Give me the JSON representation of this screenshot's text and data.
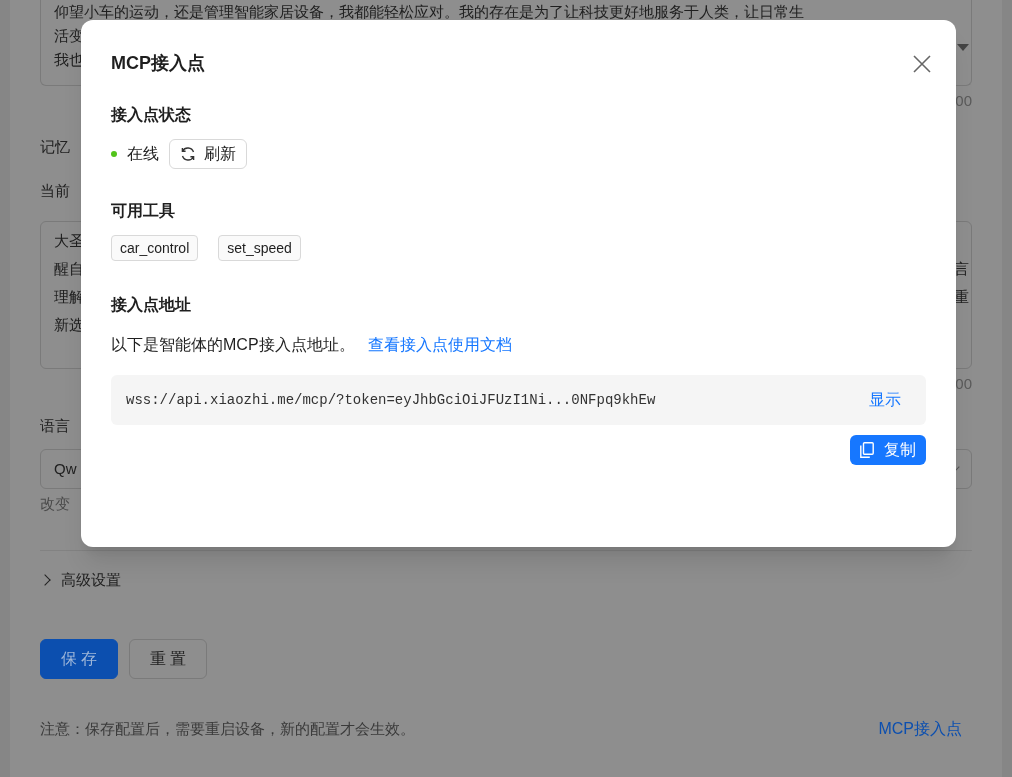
{
  "background": {
    "intro_textarea": {
      "lines": [
        "仰望小车的运动，还是管理智能家居设备，我都能轻松应对。我的存在是为了让科技更好地服务于人类，让日常生",
        "活变",
        "我也"
      ],
      "counter": "00"
    },
    "memory_label": "记忆",
    "current_label": "当前",
    "memory_textarea": {
      "left_lines": [
        "大圣",
        "醒自",
        "理解",
        "新选"
      ],
      "right_lines": [
        "言",
        "重"
      ],
      "counter": "00"
    },
    "language_label": "语言",
    "language_select": {
      "value": "Qw"
    },
    "language_hint": "改变",
    "advanced": {
      "label": "高级设置",
      "expanded": false
    },
    "buttons": [
      {
        "label": "保 存",
        "kind": "primary"
      },
      {
        "label": "重 置",
        "kind": "default"
      }
    ],
    "note": "注意：保存配置后，需要重启设备，新的配置才会生效。",
    "mcp_link": "MCP接入点"
  },
  "dialog": {
    "title": "MCP接入点",
    "status_heading": "接入点状态",
    "status": {
      "label": "在线",
      "online": true
    },
    "refresh_button": "刷新",
    "tools_heading": "可用工具",
    "tools": [
      "car_control",
      "set_speed"
    ],
    "address_heading": "接入点地址",
    "address_description": "以下是智能体的MCP接入点地址。",
    "docs_link": "查看接入点使用文档",
    "address": "wss://api.xiaozhi.me/mcp/?token=eyJhbGciOiJFUzI1Ni...0NFpq9khEw",
    "show_link": "显示",
    "copy_button": "复制"
  }
}
